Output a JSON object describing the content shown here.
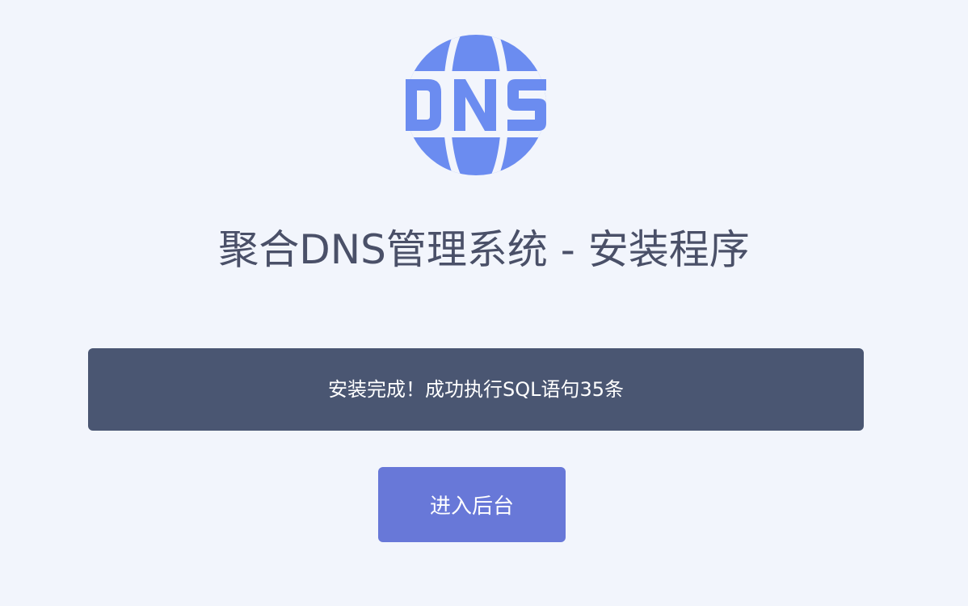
{
  "logo": {
    "text": "DNS",
    "icon": "globe-dns-icon",
    "color": "#6b8cf0"
  },
  "header": {
    "title": "聚合DNS管理系统 - 安装程序"
  },
  "notice": {
    "message": "安装完成！成功执行SQL语句35条"
  },
  "actions": {
    "enter_label": "进入后台"
  },
  "colors": {
    "background": "#f2f5fc",
    "notice_bg": "#4a5672",
    "button_bg": "#6878d8",
    "title_text": "#4a5068"
  }
}
